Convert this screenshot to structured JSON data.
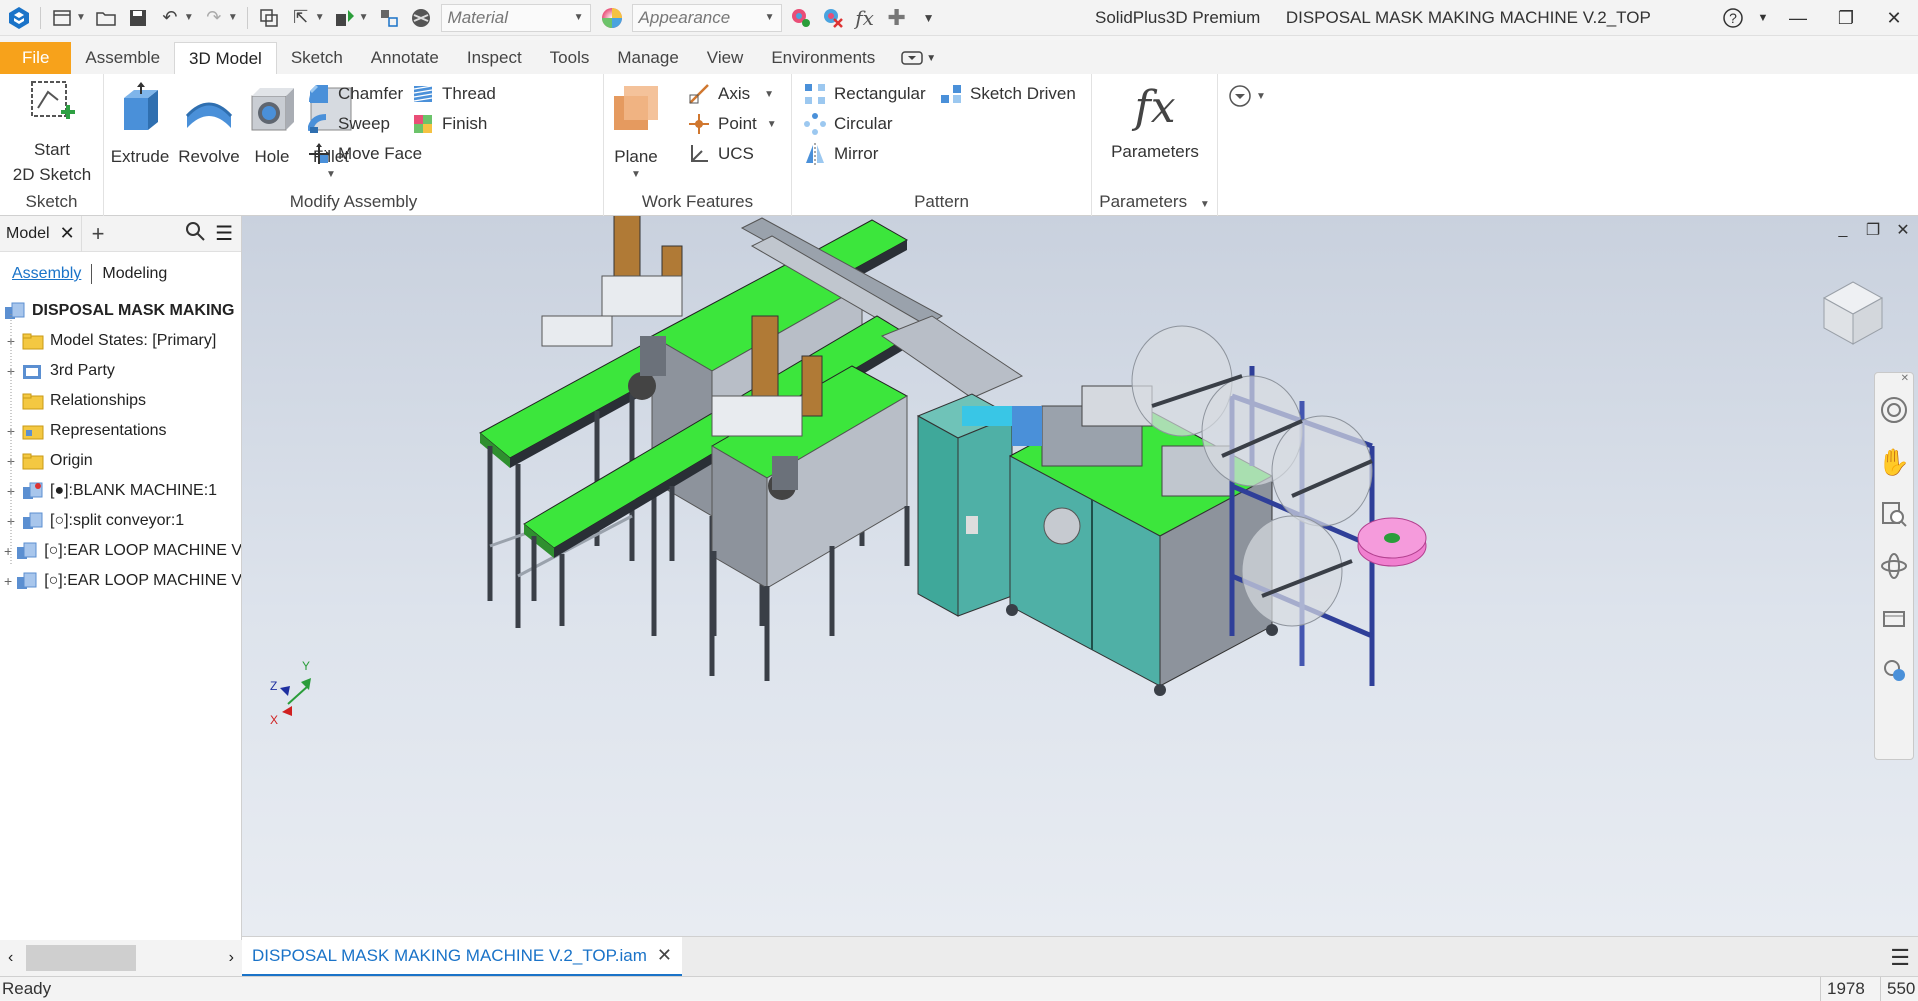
{
  "app": {
    "name": "SolidPlus3D Premium",
    "document": "DISPOSAL MASK MAKING MACHINE V.2_TOP"
  },
  "quick_access": {
    "material_placeholder": "Material",
    "appearance_placeholder": "Appearance"
  },
  "tabs": [
    "File",
    "Assemble",
    "3D Model",
    "Sketch",
    "Annotate",
    "Inspect",
    "Tools",
    "Manage",
    "View",
    "Environments"
  ],
  "active_tab": "3D Model",
  "ribbon": {
    "sketch": {
      "start_label": "Start\n2D Sketch",
      "panel": "Sketch"
    },
    "modify": {
      "panel": "Modify Assembly",
      "extrude": "Extrude",
      "revolve": "Revolve",
      "hole": "Hole",
      "fillet": "Fillet",
      "chamfer": "Chamfer",
      "thread": "Thread",
      "sweep": "Sweep",
      "finish": "Finish",
      "move_face": "Move Face"
    },
    "work": {
      "panel": "Work Features",
      "plane": "Plane",
      "axis": "Axis",
      "point": "Point",
      "ucs": "UCS"
    },
    "pattern": {
      "panel": "Pattern",
      "rectangular": "Rectangular",
      "sketch_driven": "Sketch Driven",
      "circular": "Circular",
      "mirror": "Mirror"
    },
    "parameters": {
      "panel": "Parameters",
      "button": "Parameters"
    }
  },
  "browser": {
    "title": "Model",
    "tab_assembly": "Assembly",
    "tab_modeling": "Modeling",
    "root": "DISPOSAL MASK MAKING",
    "items": [
      {
        "label": "Model States: [Primary]",
        "icon": "folder-icon"
      },
      {
        "label": "3rd Party",
        "icon": "third-party-icon"
      },
      {
        "label": "Relationships",
        "icon": "folder-icon"
      },
      {
        "label": "Representations",
        "icon": "representations-icon"
      },
      {
        "label": "Origin",
        "icon": "folder-icon"
      },
      {
        "label": "[●]:BLANK MACHINE:1",
        "icon": "subassembly-icon"
      },
      {
        "label": "[○]:split conveyor:1",
        "icon": "part-icon"
      },
      {
        "label": "[○]:EAR LOOP MACHINE V",
        "icon": "part-icon"
      },
      {
        "label": "[○]:EAR LOOP MACHINE V",
        "icon": "part-icon"
      }
    ]
  },
  "doc_tab": "DISPOSAL MASK MAKING MACHINE V.2_TOP.iam",
  "status": {
    "text": "Ready",
    "num1": "1978",
    "num2": "550"
  },
  "colors": {
    "accent": "#1a73c8",
    "file_tab": "#f7a21b",
    "conveyor_green": "#36e636",
    "frame_blue": "#2f3f99",
    "cabinet_teal": "#4fb0a6"
  }
}
